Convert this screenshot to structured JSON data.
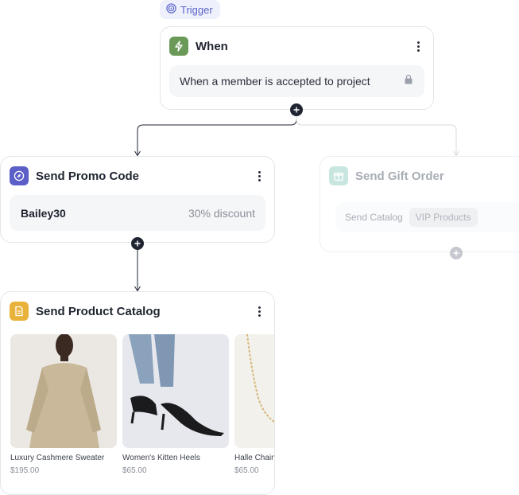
{
  "trigger": {
    "pill_label": "Trigger",
    "icon": "target-icon"
  },
  "when_card": {
    "title": "When",
    "condition": "When a member is accepted to project",
    "icon": "bolt-icon",
    "lock_icon": "lock-icon"
  },
  "promo_card": {
    "title": "Send Promo Code",
    "code": "Bailey30",
    "discount": "30% discount",
    "icon": "compass-icon"
  },
  "gift_card": {
    "title": "Send Gift Order",
    "action_label": "Send Catalog",
    "catalog_chip": "VIP Products",
    "icon": "gift-icon"
  },
  "catalog_card": {
    "title": "Send Product Catalog",
    "icon": "document-icon",
    "products": [
      {
        "name": "Luxury Cashmere Sweater",
        "price": "$195.00"
      },
      {
        "name": "Women's Kitten Heels",
        "price": "$65.00"
      },
      {
        "name": "Halle Chain",
        "price": "$65.00"
      }
    ]
  },
  "colors": {
    "accent": "#5b66c9",
    "bolt_green": "#6b9a58",
    "promo_purple": "#5b5fc7",
    "catalog_yellow": "#e9b23a",
    "gift_teal": "#9fd3c9",
    "connector": "#1f2430"
  }
}
